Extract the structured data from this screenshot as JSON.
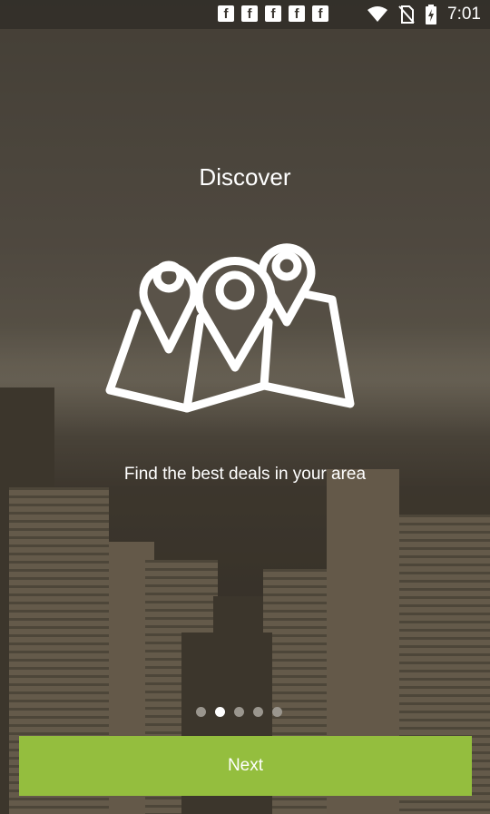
{
  "status_bar": {
    "notification_icons": [
      "f",
      "f",
      "f",
      "f",
      "f"
    ],
    "time": "7:01",
    "icons": [
      "wifi-icon",
      "no-sim-icon",
      "battery-charging-icon"
    ]
  },
  "onboarding": {
    "title": "Discover",
    "subtitle": "Find the best deals in your area",
    "image_icon": "map-pins-icon",
    "page_count": 5,
    "active_page": 1,
    "next_label": "Next"
  },
  "colors": {
    "accent": "#94be3e",
    "text": "#ffffff",
    "dot_inactive": "#9a968e",
    "dot_active": "#ffffff"
  }
}
